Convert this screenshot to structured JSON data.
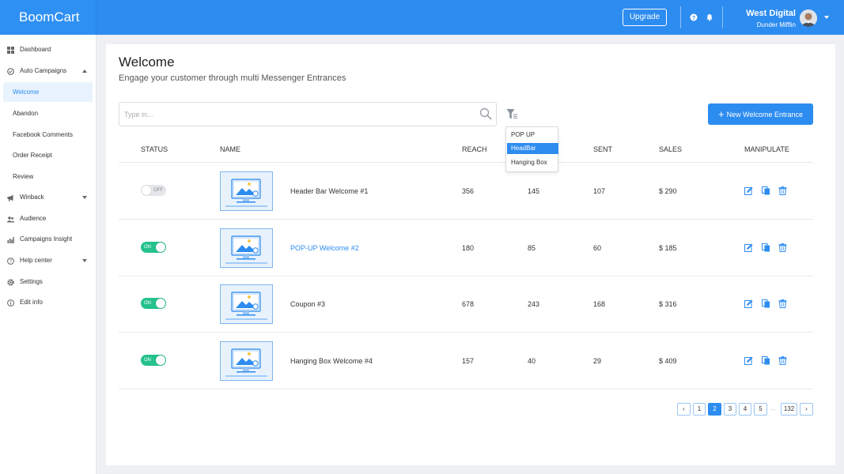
{
  "header": {
    "brand": "BoomCart",
    "upgrade_label": "Upgrade",
    "user_name": "West Digital",
    "user_org": "Dunder Mifflin",
    "icons": [
      "help-icon",
      "bell-icon",
      "chevron-down-icon"
    ]
  },
  "sidebar": {
    "items": [
      {
        "label": "Dashboard",
        "icon": "grid-icon"
      },
      {
        "label": "Auto Campaigns",
        "icon": "campaign-icon",
        "expanded": true
      },
      {
        "label": "Winback",
        "icon": "megaphone-icon",
        "expanded": false
      },
      {
        "label": "Audience",
        "icon": "people-icon"
      },
      {
        "label": "Campaigns Insight",
        "icon": "chart-icon"
      },
      {
        "label": "Help center",
        "icon": "help-icon",
        "expanded": false
      },
      {
        "label": "Settings",
        "icon": "gear-icon"
      },
      {
        "label": "Edit info",
        "icon": "info-icon"
      }
    ],
    "sub_items": [
      "Welcome",
      "Abandon",
      "Facebook Comments",
      "Order Receipt",
      "Review"
    ],
    "active_sub": "Welcome"
  },
  "main": {
    "title": "Welcome",
    "subtitle": "Engage your customer through multi Messenger Entrances",
    "search_placeholder": "Type in...",
    "new_button_label": "New Welcome Entrance",
    "filter_options": [
      "POP UP",
      "HeadBar",
      "Hanging Box"
    ],
    "filter_selected": "HeadBar"
  },
  "table": {
    "columns": [
      "STATUS",
      "NAME",
      "REACH",
      "SENT",
      "SALES",
      "MANIPULATE"
    ],
    "rows": [
      {
        "status": "OFF",
        "name": "Header Bar Welcome #1",
        "reach": "356",
        "col4": "145",
        "sent": "107",
        "sales": "$ 290",
        "link": false
      },
      {
        "status": "ON",
        "name": "POP-UP Welcome #2",
        "reach": "180",
        "col4": "85",
        "sent": "60",
        "sales": "$ 185",
        "link": true
      },
      {
        "status": "ON",
        "name": "Coupon #3",
        "reach": "678",
        "col4": "243",
        "sent": "168",
        "sales": "$ 316",
        "link": false
      },
      {
        "status": "ON",
        "name": "Hanging Box Welcome #4",
        "reach": "157",
        "col4": "40",
        "sent": "29",
        "sales": "$ 409",
        "link": false
      }
    ]
  },
  "pagination": {
    "prev": "‹",
    "next": "›",
    "pages": [
      "1",
      "2",
      "3",
      "4",
      "5"
    ],
    "ellipsis": "...",
    "last": "132",
    "current": "2"
  },
  "colors": {
    "primary": "#2d8cf0",
    "toggle_on": "#25c18e",
    "toggle_off": "#e4e6e9"
  }
}
